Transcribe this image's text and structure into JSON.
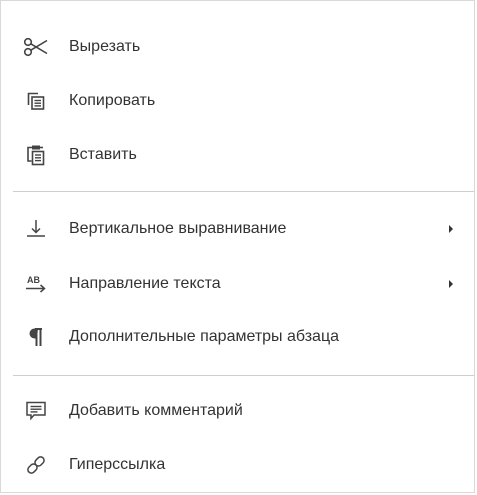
{
  "menu": {
    "items": {
      "cut": {
        "label": "Вырезать",
        "icon": "scissors-icon"
      },
      "copy": {
        "label": "Копировать",
        "icon": "copy-icon"
      },
      "paste": {
        "label": "Вставить",
        "icon": "paste-icon"
      },
      "vertical_align": {
        "label": "Вертикальное выравнивание",
        "icon": "vertical-align-bottom-icon",
        "has_submenu": true
      },
      "text_direction": {
        "label": "Направление текста",
        "icon": "text-direction-icon",
        "has_submenu": true
      },
      "paragraph_settings": {
        "label": "Дополнительные параметры абзаца",
        "icon": "paragraph-icon"
      },
      "add_comment": {
        "label": "Добавить комментарий",
        "icon": "comment-icon"
      },
      "hyperlink": {
        "label": "Гиперссылка",
        "icon": "link-icon"
      }
    }
  },
  "colors": {
    "text": "#333333",
    "icon": "#444444",
    "divider": "#cfcfcf",
    "border": "#d9d9d9",
    "background": "#ffffff"
  }
}
